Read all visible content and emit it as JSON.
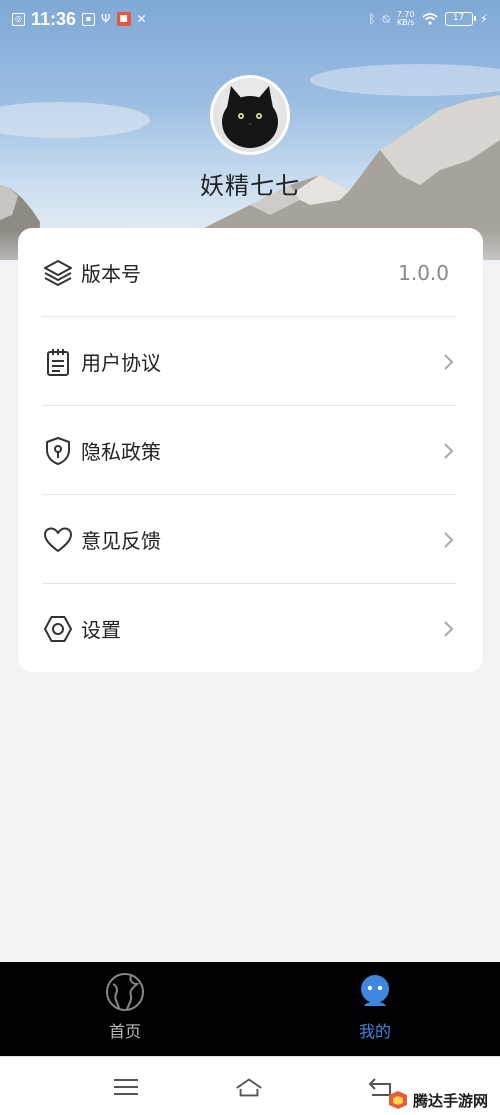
{
  "status_bar": {
    "time": "11:36",
    "net_speed_value": "7.70",
    "net_speed_unit": "KB/s",
    "battery": "17"
  },
  "profile": {
    "username": "妖精七七"
  },
  "menu": {
    "items": [
      {
        "label": "版本号",
        "value": "1.0.0",
        "icon": "layers-icon"
      },
      {
        "label": "用户协议",
        "icon": "clipboard-icon"
      },
      {
        "label": "隐私政策",
        "icon": "shield-icon"
      },
      {
        "label": "意见反馈",
        "icon": "heart-icon"
      },
      {
        "label": "设置",
        "icon": "hexagon-icon"
      }
    ]
  },
  "tabbar": {
    "tabs": [
      {
        "label": "首页",
        "icon": "globe-icon",
        "active": false
      },
      {
        "label": "我的",
        "icon": "user-icon",
        "active": true
      }
    ],
    "active_color": "#3f86e0"
  },
  "watermark": {
    "text": "腾达手游网"
  }
}
